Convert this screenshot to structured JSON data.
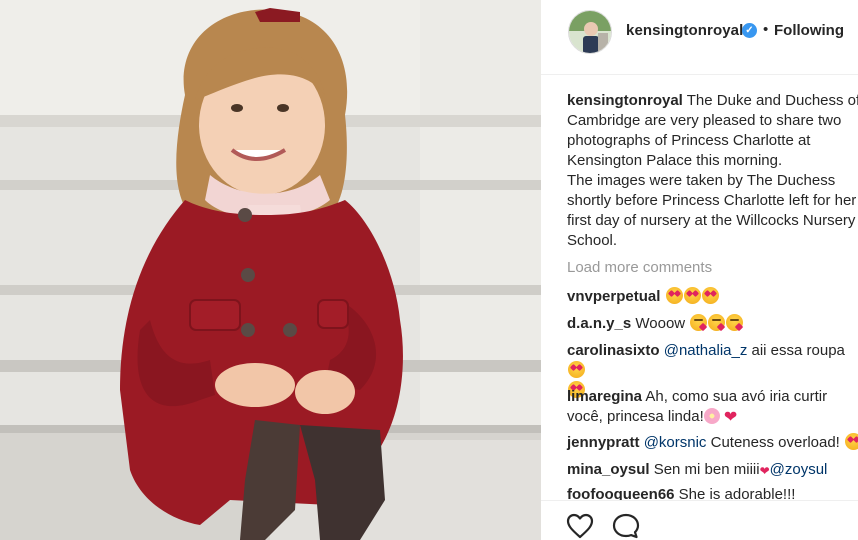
{
  "post": {
    "photo_alt": "Princess Charlotte in red coat sitting on steps",
    "author": {
      "username": "kensingtonroyal",
      "verified_icon": "verified-badge-icon",
      "separator": "•",
      "follow_status": "Following"
    },
    "caption": {
      "username": "kensingtonroyal",
      "text": " The Duke and Duchess of Cambridge are very pleased to share two photographs of Princess Charlotte at Kensington Palace this morning.",
      "text2": "The images were taken by The Duchess shortly before Princess Charlotte left for her first day of nursery at the Willcocks Nursery School."
    },
    "load_more": "Load more comments",
    "comments": [
      {
        "username": "vnvperpetual",
        "text": "",
        "emojis": [
          "smiling-face-with-heart-eyes",
          "smiling-face-with-heart-eyes",
          "smiling-face-with-heart-eyes"
        ]
      },
      {
        "username": "d.a.n.y_s",
        "text": " Wooow ",
        "emojis": [
          "face-blowing-a-kiss",
          "face-blowing-a-kiss",
          "face-blowing-a-kiss"
        ]
      },
      {
        "username": "carolinasixto",
        "mention": "@nathalia_z",
        "text": " aii essa roupa ",
        "emojis": [
          "smiling-face-with-heart-eyes",
          "smiling-face-with-heart-eyes"
        ]
      },
      {
        "username": "limaregina",
        "text": " Ah, como sua avó iria curtir você, princesa linda!",
        "emojis": [
          "cherry-blossom",
          "red-heart"
        ]
      },
      {
        "username": "jennypratt",
        "mention": "@korsnic",
        "text": " Cuteness overload! ",
        "emojis": [
          "smiling-face-with-heart-eyes"
        ]
      },
      {
        "username": "mina_oysul",
        "text": " Sen mi ben miiii",
        "mention": "@zoysul",
        "emojis": [
          "red-heart"
        ]
      },
      {
        "username": "foofooqueen66",
        "text": " She is adorable!!!"
      }
    ],
    "actions": {
      "like_icon": "heart-outline-icon",
      "comment_icon": "speech-bubble-icon"
    }
  },
  "colors": {
    "text": "#262626",
    "muted": "#999999",
    "mention": "#003569",
    "verified": "#3897f0",
    "heart": "#e0245e",
    "coat": "#9b1a24"
  }
}
